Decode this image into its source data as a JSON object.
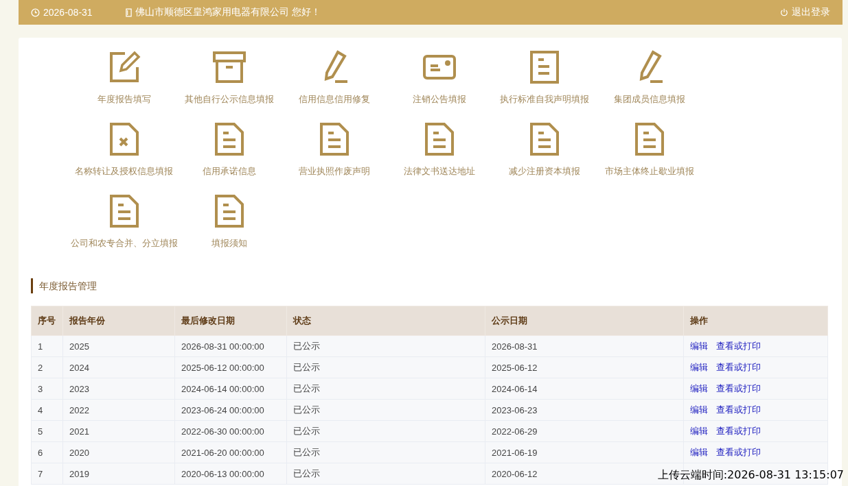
{
  "header": {
    "date": "2026-08-31",
    "greeting": "佛山市顺德区皇鸿家用电器有限公司 您好！",
    "logout": "退出登录"
  },
  "tiles": [
    {
      "kind": "edit",
      "label": "年度报告填写"
    },
    {
      "kind": "box",
      "label": "其他自行公示信息填报"
    },
    {
      "kind": "pencil",
      "label": "信用信息信用修复"
    },
    {
      "kind": "card",
      "label": "注销公告填报"
    },
    {
      "kind": "page",
      "label": "执行标准自我声明填报"
    },
    {
      "kind": "pencil",
      "label": "集团成员信息填报"
    },
    {
      "kind": "docx",
      "label": "名称转让及授权信息填报"
    },
    {
      "kind": "doc",
      "label": "信用承诺信息"
    },
    {
      "kind": "doc",
      "label": "营业执照作废声明"
    },
    {
      "kind": "doc",
      "label": "法律文书送达地址"
    },
    {
      "kind": "doc",
      "label": "减少注册资本填报"
    },
    {
      "kind": "doc",
      "label": "市场主体终止歇业填报"
    },
    {
      "kind": "doc",
      "label": "公司和农专合并、分立填报"
    },
    {
      "kind": "doc",
      "label": "填报须知"
    }
  ],
  "section_title": "年度报告管理",
  "table": {
    "columns": [
      "序号",
      "报告年份",
      "最后修改日期",
      "状态",
      "公示日期",
      "操作"
    ],
    "rows": [
      {
        "cells": [
          "1",
          "2025",
          "2026-08-31 00:00:00",
          "已公示",
          "2026-08-31"
        ],
        "actions": [
          "编辑",
          "查看或打印"
        ]
      },
      {
        "cells": [
          "2",
          "2024",
          "2025-06-12 00:00:00",
          "已公示",
          "2025-06-12"
        ],
        "actions": [
          "编辑",
          "查看或打印"
        ]
      },
      {
        "cells": [
          "3",
          "2023",
          "2024-06-14 00:00:00",
          "已公示",
          "2024-06-14"
        ],
        "actions": [
          "编辑",
          "查看或打印"
        ]
      },
      {
        "cells": [
          "4",
          "2022",
          "2023-06-24 00:00:00",
          "已公示",
          "2023-06-23"
        ],
        "actions": [
          "编辑",
          "查看或打印"
        ]
      },
      {
        "cells": [
          "5",
          "2021",
          "2022-06-30 00:00:00",
          "已公示",
          "2022-06-29"
        ],
        "actions": [
          "编辑",
          "查看或打印"
        ]
      },
      {
        "cells": [
          "6",
          "2020",
          "2021-06-20 00:00:00",
          "已公示",
          "2021-06-19"
        ],
        "actions": [
          "编辑",
          "查看或打印"
        ]
      },
      {
        "cells": [
          "7",
          "2019",
          "2020-06-13 00:00:00",
          "已公示",
          "2020-06-12"
        ]
      }
    ]
  },
  "upload_stamp": "上传云端时间:2026-08-31 13:15:07"
}
